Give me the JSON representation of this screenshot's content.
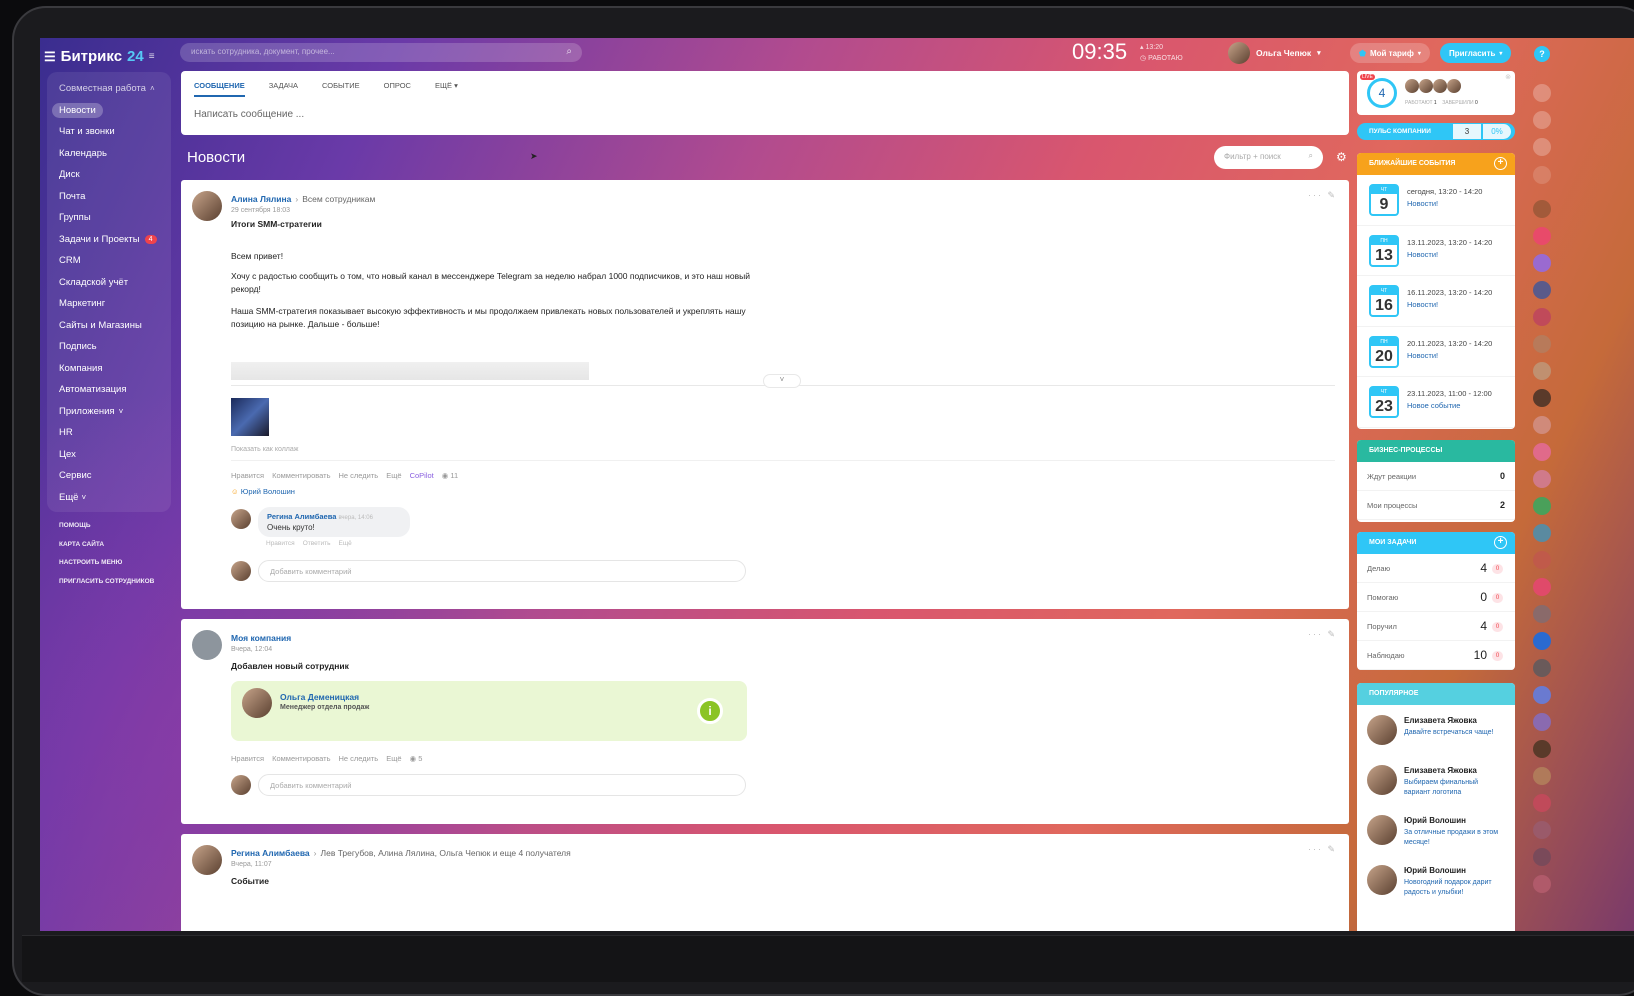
{
  "app": {
    "logo_text": "Битрикс",
    "logo_num": "24"
  },
  "search": {
    "placeholder": "искать сотрудника, документ, прочее..."
  },
  "clock": {
    "time": "09:35",
    "meta_time": "13:20",
    "status": "РАБОТАЮ"
  },
  "user": {
    "name": "Ольга Чепюк"
  },
  "buttons": {
    "tariff": "Мой тариф",
    "invite": "Пригласить",
    "help": "?"
  },
  "sidebar": {
    "group": "Совместная работа",
    "items": [
      "Новости",
      "Чат и звонки",
      "Календарь",
      "Диск",
      "Почта",
      "Группы",
      "Задачи и Проекты",
      "CRM",
      "Складской учёт",
      "Маркетинг",
      "Сайты и Магазины",
      "Подпись",
      "Компания",
      "Автоматизация",
      "Приложения",
      "HR",
      "Цех",
      "Сервис",
      "Ещё"
    ],
    "tasks_badge": "4",
    "links": [
      "ПОМОЩЬ",
      "КАРТА САЙТА",
      "НАСТРОИТЬ МЕНЮ",
      "ПРИГЛАСИТЬ СОТРУДНИКОВ"
    ]
  },
  "composer": {
    "tabs": [
      "СООБЩЕНИЕ",
      "ЗАДАЧА",
      "СОБЫТИЕ",
      "ОПРОС",
      "ЕЩЁ"
    ],
    "placeholder": "Написать сообщение ..."
  },
  "feed": {
    "title": "Новости",
    "filter_placeholder": "Фильтр + поиск"
  },
  "post1": {
    "author": "Алина Лялина",
    "audience": "Всем сотрудникам",
    "date": "29 сентября 18:03",
    "title": "Итоги SMM-стратегии",
    "greeting": "Всем привет!",
    "p1": "Хочу с радостью сообщить о том, что новый канал в мессенджере Telegram за неделю набрал 1000 подписчиков, и это наш новый рекорд!",
    "p2": "Наша SMM-стратегия показывает высокую эффективность и мы продолжаем привлекать новых пользователей и укреплять нашу позицию на рынке. Дальше - больше!",
    "collage": "Показать как коллаж",
    "actions": [
      "Нравится",
      "Комментировать",
      "Не следить",
      "Ещё",
      "CoPilot"
    ],
    "views": "11",
    "liker": "Юрий Волошин",
    "comment_author": "Регина Алимбаева",
    "comment_date": "вчера, 14:06",
    "comment_text": "Очень круто!",
    "comment_actions": [
      "Нравится",
      "Ответить",
      "Ещё"
    ],
    "comment_placeholder": "Добавить комментарий"
  },
  "post2": {
    "author": "Моя компания",
    "date": "Вчера, 12:04",
    "title": "Добавлен новый сотрудник",
    "employee_name": "Ольга Деменицкая",
    "employee_role": "Менеджер отдела продаж",
    "actions": [
      "Нравится",
      "Комментировать",
      "Не следить",
      "Ещё"
    ],
    "views": "5",
    "comment_placeholder": "Добавить комментарий"
  },
  "post3": {
    "author": "Регина Алимбаева",
    "audience": "Лев Трегубов, Алина Лялина, Ольга Чепюк  и еще 4 получателя",
    "date": "Вчера, 11:07",
    "title": "Событие"
  },
  "stream": {
    "count": "4",
    "working_label": "РАБОТАЮТ",
    "working": "1",
    "done_label": "ЗАВЕРШИЛИ",
    "done": "0",
    "live": "LIVE"
  },
  "pulse": {
    "label": "ПУЛЬС КОМПАНИИ",
    "value": "3",
    "percent": "0%"
  },
  "events": {
    "title": "БЛИЖАЙШИЕ СОБЫТИЯ",
    "items": [
      {
        "dow": "ЧТ",
        "day": "9",
        "time": "сегодня, 13:20 - 14:20",
        "name": "Новости!"
      },
      {
        "dow": "ПН",
        "day": "13",
        "time": "13.11.2023, 13:20 - 14:20",
        "name": "Новости!"
      },
      {
        "dow": "ЧТ",
        "day": "16",
        "time": "16.11.2023, 13:20 - 14:20",
        "name": "Новости!"
      },
      {
        "dow": "ПН",
        "day": "20",
        "time": "20.11.2023, 13:20 - 14:20",
        "name": "Новости!"
      },
      {
        "dow": "ЧТ",
        "day": "23",
        "time": "23.11.2023, 11:00 - 12:00",
        "name": "Новое событие"
      }
    ]
  },
  "bp": {
    "title": "БИЗНЕС-ПРОЦЕССЫ",
    "rows": [
      {
        "label": "Ждут реакции",
        "value": "0"
      },
      {
        "label": "Мои процессы",
        "value": "2"
      }
    ]
  },
  "tasks": {
    "title": "МОИ ЗАДАЧИ",
    "rows": [
      {
        "label": "Делаю",
        "value": "4",
        "z": "0"
      },
      {
        "label": "Помогаю",
        "value": "0",
        "z": "0"
      },
      {
        "label": "Поручил",
        "value": "4",
        "z": "0"
      },
      {
        "label": "Наблюдаю",
        "value": "10",
        "z": "0"
      }
    ]
  },
  "popular": {
    "title": "ПОПУЛЯРНОЕ",
    "items": [
      {
        "name": "Елизавета Яжовка",
        "text": "Давайте встречаться чаще!"
      },
      {
        "name": "Елизавета Яжовка",
        "text": "Выбираем финальный вариант логотипа"
      },
      {
        "name": "Юрий Волошин",
        "text": "За отличные продажи в этом месяце!"
      },
      {
        "name": "Юрий Волошин",
        "text": "Новогодний подарок дарит радость и улыбки!"
      }
    ]
  },
  "colors": {
    "accent": "#2fc6f6",
    "link": "#2067b0",
    "events": "#f7a21c",
    "bp": "#29b9a0",
    "tasks": "#2fc6f6",
    "popular": "#55d0e0"
  }
}
